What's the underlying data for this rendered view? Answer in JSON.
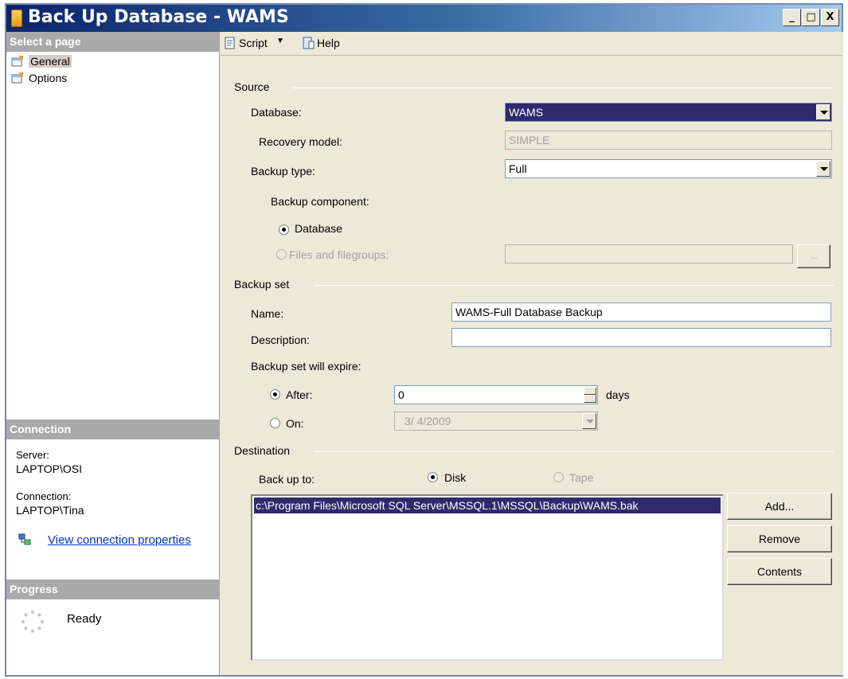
{
  "window": {
    "title": "Back Up Database - WAMS",
    "minimize_glyph": "_",
    "maximize_glyph": "□",
    "close_glyph": "X"
  },
  "left": {
    "select_page_header": "Select a page",
    "pages": [
      {
        "label": "General",
        "icon": "page-icon"
      },
      {
        "label": "Options",
        "icon": "page-icon"
      }
    ],
    "connection_header": "Connection",
    "server_label": "Server:",
    "server_value": "LAPTOP\\OSI",
    "connection_label": "Connection:",
    "connection_value": "LAPTOP\\Tina",
    "view_connection_link": "View connection properties",
    "progress_header": "Progress",
    "progress_status": "Ready"
  },
  "toolbar": {
    "script_label": "Script",
    "help_label": "Help"
  },
  "source": {
    "group_label": "Source",
    "database_label": "Database:",
    "database_value": "WAMS",
    "recovery_label": "Recovery model:",
    "recovery_value": "SIMPLE",
    "backup_type_label": "Backup type:",
    "backup_type_value": "Full",
    "component_label": "Backup component:",
    "component_database": "Database",
    "component_files": "Files and filegroups:",
    "browse_label": "..."
  },
  "backup_set": {
    "group_label": "Backup set",
    "name_label": "Name:",
    "name_value": "WAMS-Full Database Backup",
    "description_label": "Description:",
    "description_value": "",
    "expire_label": "Backup set will expire:",
    "after_label": "After:",
    "after_value": "0",
    "days_label": "days",
    "on_label": "On:",
    "on_value": "3/ 4/2009"
  },
  "destination": {
    "group_label": "Destination",
    "backup_to_label": "Back up to:",
    "disk_label": "Disk",
    "tape_label": "Tape",
    "paths": [
      "c:\\Program Files\\Microsoft SQL Server\\MSSQL.1\\MSSQL\\Backup\\WAMS.bak"
    ],
    "add_button": "Add...",
    "remove_button": "Remove",
    "contents_button": "Contents"
  },
  "colors": {
    "title_gradient_start": "#0a246a",
    "selection": "#2e2a6e",
    "dialog_bg": "#ece9d8",
    "section_header": "#a9a9a9",
    "link": "#0033cc"
  }
}
